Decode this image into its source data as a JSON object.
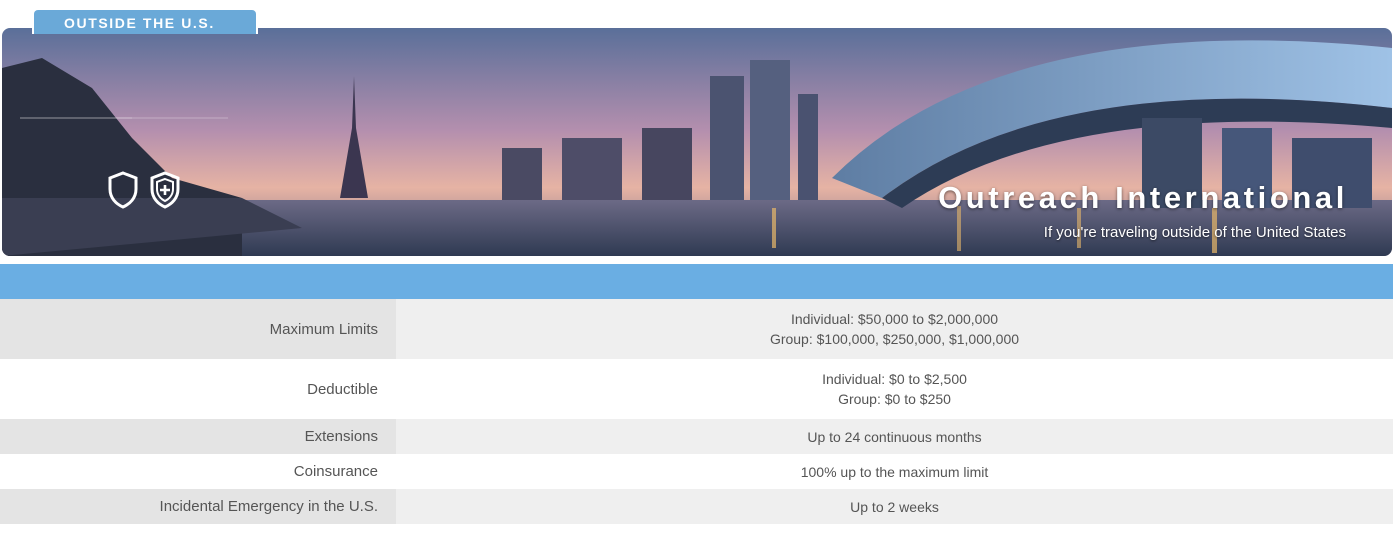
{
  "tab": {
    "label": "OUTSIDE THE U.S."
  },
  "banner": {
    "title": "Outreach International",
    "subtitle": "If you're traveling outside of the United States",
    "icons": [
      "shield-outline-icon",
      "shield-plus-icon"
    ]
  },
  "table": {
    "rows": [
      {
        "label": "Maximum Limits",
        "values": [
          "Individual: $50,000 to $2,000,000",
          "Group: $100,000, $250,000, $1,000,000"
        ]
      },
      {
        "label": "Deductible",
        "values": [
          "Individual: $0 to $2,500",
          "Group: $0 to $250"
        ]
      },
      {
        "label": "Extensions",
        "values": [
          "Up to 24 continuous months"
        ]
      },
      {
        "label": "Coinsurance",
        "values": [
          "100% up to the maximum limit"
        ]
      },
      {
        "label": "Incidental Emergency in the U.S.",
        "values": [
          "Up to 2 weeks"
        ]
      }
    ]
  },
  "colors": {
    "accent": "#6aaee3",
    "tab": "#6aa9d8",
    "row_shade": "#efefef",
    "text": "#555555"
  }
}
